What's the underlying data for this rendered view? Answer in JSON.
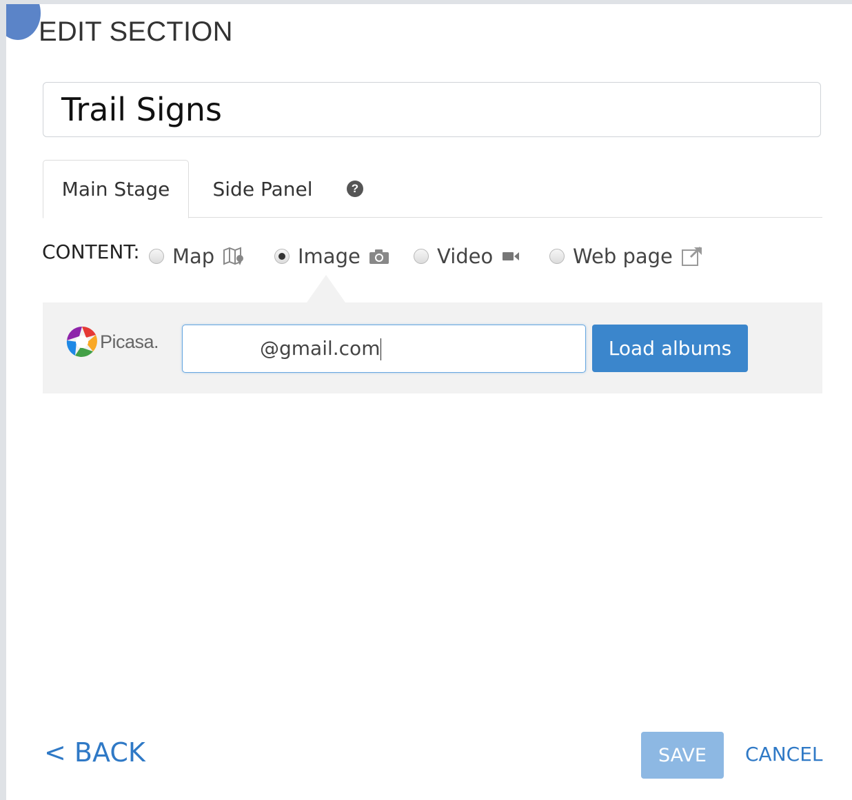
{
  "dialog": {
    "title": "EDIT SECTION",
    "section_title_value": "Trail Signs"
  },
  "tabs": [
    {
      "label": "Main Stage",
      "active": true
    },
    {
      "label": "Side Panel",
      "active": false
    }
  ],
  "help_icon_glyph": "?",
  "content": {
    "label": "CONTENT:",
    "options": [
      {
        "label": "Map",
        "icon": "map-icon",
        "selected": false
      },
      {
        "label": "Image",
        "icon": "camera-icon",
        "selected": true
      },
      {
        "label": "Video",
        "icon": "video-camera-icon",
        "selected": false
      },
      {
        "label": "Web page",
        "icon": "external-link-icon",
        "selected": false
      }
    ]
  },
  "picasa": {
    "brand": "Picasa.",
    "email_value": "@gmail.com",
    "load_button": "Load albums"
  },
  "footer": {
    "back": "< BACK",
    "save": "SAVE",
    "cancel": "CANCEL"
  },
  "colors": {
    "accent": "#3b86cc",
    "save_disabled": "#8db8e3",
    "link": "#2f79c6"
  }
}
